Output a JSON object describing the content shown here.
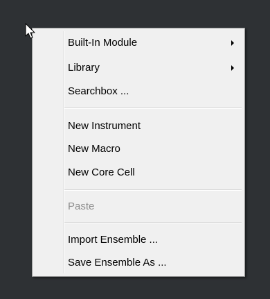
{
  "menu": {
    "items": [
      {
        "label": "Built-In Module",
        "submenu": true,
        "enabled": true
      },
      {
        "label": "Library",
        "submenu": true,
        "enabled": true
      },
      {
        "label": "Searchbox ...",
        "submenu": false,
        "enabled": true
      },
      {
        "label": "New Instrument",
        "submenu": false,
        "enabled": true
      },
      {
        "label": "New Macro",
        "submenu": false,
        "enabled": true
      },
      {
        "label": "New Core Cell",
        "submenu": false,
        "enabled": true
      },
      {
        "label": "Paste",
        "submenu": false,
        "enabled": false
      },
      {
        "label": "Import Ensemble ...",
        "submenu": false,
        "enabled": true
      },
      {
        "label": "Save Ensemble As ...",
        "submenu": false,
        "enabled": true
      }
    ]
  },
  "colors": {
    "background": "#2e3134",
    "menu_background": "#f0f0f0",
    "text": "#000000",
    "disabled_text": "#8d8d8d"
  },
  "icons": {
    "cursor": "arrow-cursor-icon",
    "submenu": "submenu-arrow-icon"
  }
}
